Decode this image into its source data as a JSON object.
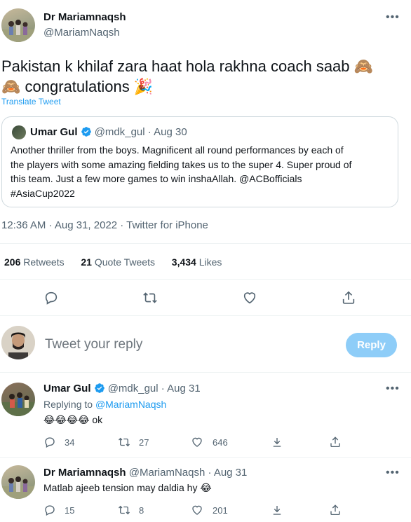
{
  "main_tweet": {
    "name": "Dr Mariamnaqsh",
    "handle": "@MariamNaqsh",
    "text_line1": "Pakistan k khilaf zara haat hola rakhna coach saab",
    "text_line2": "congratulations",
    "translate": "Translate Tweet",
    "quoted": {
      "name": "Umar Gul",
      "handle": "@mdk_gul",
      "sep": "·",
      "date": "Aug 30",
      "line1": "Another thriller from the boys. Magnificent all round performances by each of",
      "line2": "the players with some amazing fielding takes us to the super 4. Super proud of",
      "line3": "this team. Just a few more games to win inshaAllah. @ACBofficials",
      "line4": "#AsiaCup2022"
    },
    "timestamp": "12:36 AM · Aug 31, 2022 · Twitter for iPhone",
    "stats": {
      "retweets_count": "206",
      "retweets_label": "Retweets",
      "quotes_count": "21",
      "quotes_label": "Quote Tweets",
      "likes_count": "3,434",
      "likes_label": "Likes"
    }
  },
  "reply_box": {
    "placeholder": "Tweet your reply",
    "button": "Reply"
  },
  "replies": [
    {
      "name": "Umar Gul",
      "handle": "@mdk_gul",
      "sep": "·",
      "date": "Aug 31",
      "replying_prefix": "Replying to",
      "replying_to": "@MariamNaqsh",
      "text": "ok",
      "replies": "34",
      "retweets": "27",
      "likes": "646"
    },
    {
      "name": "Dr Mariamnaqsh",
      "handle": "@MariamNaqsh",
      "sep": "·",
      "date": "Aug 31",
      "text": "Matlab ajeeb tension may daldia hy",
      "replies": "15",
      "retweets": "8",
      "likes": "201"
    }
  ],
  "icons": [
    "reply-icon",
    "retweet-icon",
    "like-icon",
    "share-icon",
    "more-icon",
    "verified-icon",
    "monkey-emoji",
    "party-emoji",
    "laughing-emoji"
  ],
  "colors": {
    "accent": "#1d9bf0",
    "muted": "#536471",
    "reply_button": "#8ecdf8",
    "border": "#cfd9de"
  }
}
